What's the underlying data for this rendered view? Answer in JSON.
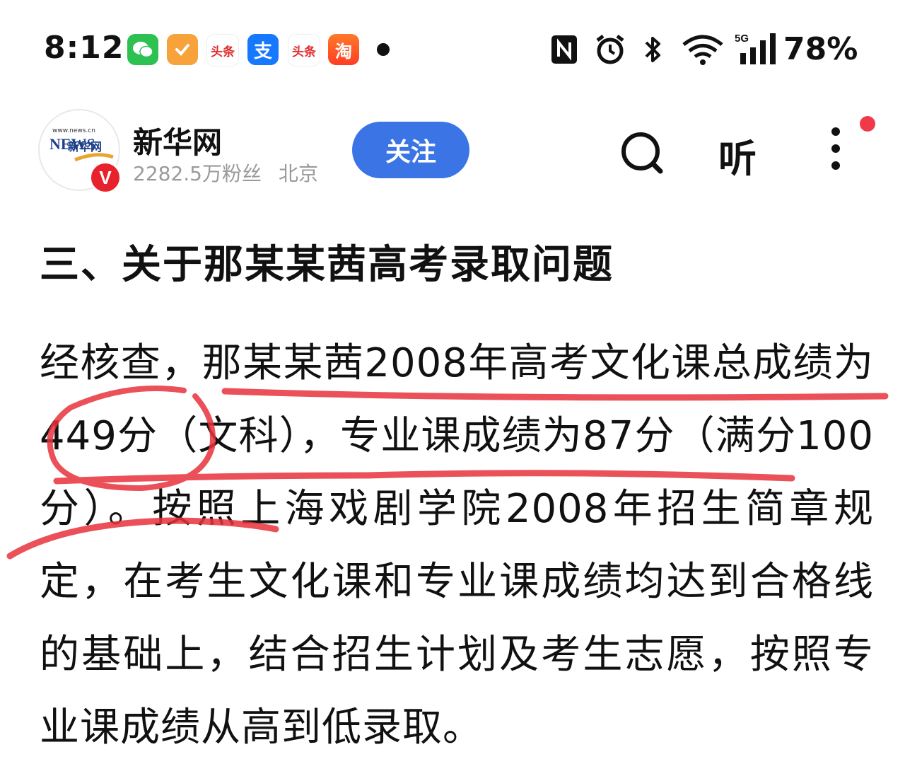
{
  "status_bar": {
    "time": "8:12",
    "notifications": [
      {
        "icon": "wechat-icon",
        "label": ""
      },
      {
        "icon": "app-orange-icon",
        "label": ""
      },
      {
        "icon": "toutiao-icon",
        "label": "头条"
      },
      {
        "icon": "alipay-icon",
        "label": "支"
      },
      {
        "icon": "toutiao-icon",
        "label": "头条"
      },
      {
        "icon": "taobao-icon",
        "label": "淘"
      }
    ],
    "network": "5G",
    "battery": "78%"
  },
  "header": {
    "account_name": "新华网",
    "followers": "2282.5万粉丝",
    "location": "北京",
    "follow_label": "关注",
    "listen_label": "听",
    "avatar_brand": "NEWS",
    "avatar_cn": "新华网",
    "avatar_url_top": "www.news.cn",
    "verified_badge": "V"
  },
  "article": {
    "heading": "三、关于那某某茜高考录取问题",
    "paragraph": "经核查，那某某茜2008年高考文化课总成绩为449分（文科），专业课成绩为87分（满分100分）。按照上海戏剧学院2008年招生简章规定，在考生文化课和专业课成绩均达到合格线的基础上，结合招生计划及考生志愿，按照专业课成绩从高到低录取。"
  },
  "colors": {
    "follow_button": "#3b74e5",
    "annotation_red": "#e8323c",
    "verified_red": "#e8222c"
  }
}
